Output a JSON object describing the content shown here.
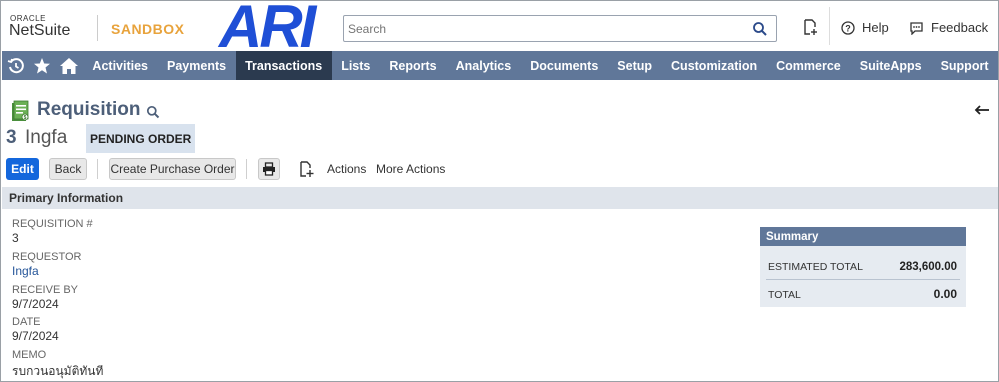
{
  "header": {
    "oracle_label": "ORACLE",
    "netsuite_label": "NetSuite",
    "environment_label": "SANDBOX",
    "company_logo_text": "ARI",
    "search_placeholder": "Search",
    "help_label": "Help",
    "feedback_label": "Feedback"
  },
  "nav": {
    "icons": [
      "recent-icon",
      "star-icon",
      "home-icon"
    ],
    "items": [
      {
        "label": "Activities"
      },
      {
        "label": "Payments"
      },
      {
        "label": "Transactions",
        "active": true
      },
      {
        "label": "Lists"
      },
      {
        "label": "Reports"
      },
      {
        "label": "Analytics"
      },
      {
        "label": "Documents"
      },
      {
        "label": "Setup"
      },
      {
        "label": "Customization"
      },
      {
        "label": "Commerce"
      },
      {
        "label": "SuiteApps"
      },
      {
        "label": "Support"
      }
    ]
  },
  "page": {
    "title": "Requisition",
    "record_number": "3",
    "record_name": "Ingfa",
    "status": "PENDING ORDER"
  },
  "buttons": {
    "edit": "Edit",
    "back": "Back",
    "create_po": "Create Purchase Order",
    "actions": "Actions",
    "more_actions": "More Actions"
  },
  "primary_info": {
    "section_title": "Primary Information",
    "fields": [
      {
        "label": "REQUISITION #",
        "value": "3"
      },
      {
        "label": "REQUESTOR",
        "value": "Ingfa"
      },
      {
        "label": "RECEIVE BY",
        "value": "9/7/2024"
      },
      {
        "label": "DATE",
        "value": "9/7/2024"
      },
      {
        "label": "MEMO",
        "value": "รบกวนอนุมัติทันที"
      }
    ]
  },
  "summary": {
    "title": "Summary",
    "estimated_total_label": "ESTIMATED TOTAL",
    "estimated_total_value": "283,600.00",
    "total_label": "TOTAL",
    "total_value": "0.00"
  },
  "colors": {
    "nav_bg": "#607799",
    "nav_active": "#2b3a4f",
    "primary_button": "#1467dc",
    "sandbox_accent": "#e8a33c",
    "logo_blue": "#1f4fd6"
  }
}
